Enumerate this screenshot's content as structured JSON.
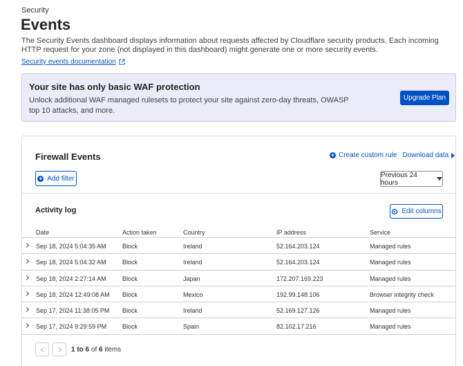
{
  "breadcrumb": "Security",
  "title": "Events",
  "description": "The Security Events dashboard displays information about requests affected by Cloudflare security products. Each incoming HTTP request for your zone (not displayed in this dashboard) might generate one or more security events.",
  "doc_link": "Security events documentation",
  "banner": {
    "title": "Your site has only basic WAF protection",
    "text": "Unlock additional WAF managed rulesets to protect your site against zero-day threats, OWASP top 10 attacks, and more.",
    "button": "Upgrade Plan"
  },
  "card": {
    "title": "Firewall Events",
    "create_rule": "Create custom rule",
    "download": "Download data",
    "add_filter": "Add filter",
    "time_range": "Previous 24 hours"
  },
  "activity": {
    "title": "Activity log",
    "edit_columns": "Edit columns",
    "columns": {
      "date": "Date",
      "action": "Action taken",
      "country": "Country",
      "ip": "IP address",
      "service": "Service"
    },
    "rows": [
      {
        "date": "Sep 18, 2024 5:04:35 AM",
        "action": "Block",
        "country": "Ireland",
        "ip": "52.164.203.124",
        "service": "Managed rules"
      },
      {
        "date": "Sep 18, 2024 5:04:32 AM",
        "action": "Block",
        "country": "Ireland",
        "ip": "52.164.203.124",
        "service": "Managed rules"
      },
      {
        "date": "Sep 18, 2024 2:27:14 AM",
        "action": "Block",
        "country": "Japan",
        "ip": "172.207.169.223",
        "service": "Managed rules"
      },
      {
        "date": "Sep 18, 2024 12:49:08 AM",
        "action": "Block",
        "country": "Mexico",
        "ip": "192.99.148.106",
        "service": "Browser integrity check"
      },
      {
        "date": "Sep 17, 2024 11:38:05 PM",
        "action": "Block",
        "country": "Ireland",
        "ip": "52.169.127.126",
        "service": "Managed rules"
      },
      {
        "date": "Sep 17, 2024 9:29:59 PM",
        "action": "Block",
        "country": "Spain",
        "ip": "82.102.17.216",
        "service": "Managed rules"
      }
    ],
    "pagination": {
      "range": "1 to 6",
      "of": "of",
      "total": "6",
      "suffix": "items"
    }
  },
  "colors": {
    "accent": "#0051c3",
    "banner_bg": "#ececf8"
  }
}
